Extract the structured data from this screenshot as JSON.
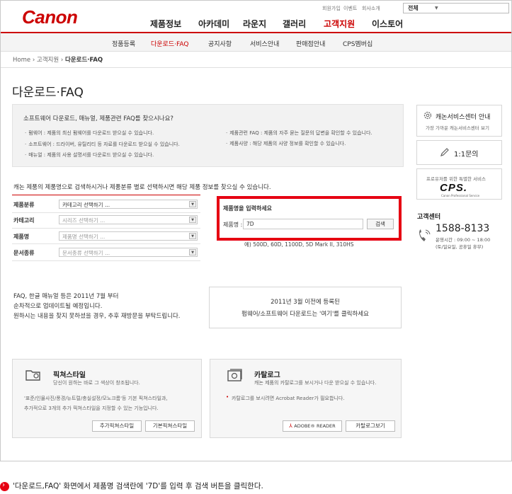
{
  "header": {
    "logo": "Canon",
    "util_links": [
      "회원가입",
      "이벤트",
      "회사소개"
    ],
    "search_select": "전체",
    "nav": [
      "제품정보",
      "아카데미",
      "라운지",
      "갤러리",
      "고객지원",
      "이스토어"
    ],
    "subnav": [
      "정품등록",
      "다운로드·FAQ",
      "공지사항",
      "서비스안내",
      "판매점안내",
      "CPS멤버십"
    ]
  },
  "breadcrumb": {
    "home": "Home",
    "level1": "고객지원",
    "current": "다운로드·FAQ"
  },
  "page_title": "다운로드·FAQ",
  "info": {
    "question": "소프트웨어 다운로드, 매뉴얼, 제품관련 FAQ를 찾으시나요?",
    "left_lines": [
      "펌웨어 : 제품의 최신 펌웨어를 다운로드 받으실 수 있습니다.",
      "소프트웨어 : 드라이버, 유틸리티 등 자료를 다운로드 받으실 수 있습니다.",
      "매뉴얼 : 제품의 사용 설명서를 다운로드 받으실 수 있습니다."
    ],
    "right_lines": [
      "제품관련 FAQ : 제품의 자주 묻는 질문의 답변을 확인할 수 있습니다.",
      "제품사양 : 해당 제품의 사양 정보를 확인할 수 있습니다."
    ]
  },
  "guide": "캐논 제품의 제품명으로 검색하시거나 제품분류 별로 선택하시면 해당 제품 정보를 찾으실 수 있습니다.",
  "filters": [
    {
      "label": "제품분류",
      "value": "카테고리 선택하기 ..."
    },
    {
      "label": "카테고리",
      "value": "시리즈 선택하기 ..."
    },
    {
      "label": "제품명",
      "value": "제품명 선택하기 ..."
    },
    {
      "label": "문서종류",
      "value": "문서종류 선택하기 ..."
    }
  ],
  "product_search": {
    "title": "제품명을 입력하세요",
    "label": "제품명 :",
    "value": "7D",
    "button": "검색",
    "example": "예) 500D, 60D, 1100D, 5D Mark II, 310HS"
  },
  "faq_notice": [
    "FAQ, 한글 매뉴얼 등은 2011년 7월 부터",
    "순차적으로 업데이트될 예정입니다.",
    "원하시는 내용을 찾지 못하셨을 경우, 추후 재방문을 부탁드립니다."
  ],
  "old_download": {
    "line1": "2011년 3월 이전에 등록된",
    "line2": "펌웨어/소프트웨어 다운로드는 '여기'를 클릭하세요"
  },
  "picture_style": {
    "title": "픽쳐스타일",
    "subtitle": "당신이 원하는 바로 그 색상이 창조됩니다.",
    "desc1": "'표준/인물사진/풍경/뉴트럴/충실설정/모노크롬'등 기본 픽쳐스타일과,",
    "desc2": "추가적으로 3개의 추가 픽쳐스타일을 지정할 수 있는 기능입니다.",
    "btn_add": "추가픽쳐스타일",
    "btn_basic": "기본픽쳐스타일"
  },
  "catalog": {
    "title": "카탈로그",
    "subtitle": "캐논 제품의 카탈로그를 보시거나 다운 받으실 수 있습니다.",
    "note": "카탈로그를 보시려면 Acrobat Reader가 필요합니다.",
    "btn_reader": "ADOBE® READER",
    "btn_view": "카탈로그보기"
  },
  "sidebar": {
    "service_title": "캐논서비스센터 안내",
    "service_sub": "가장 가까운 캐논서비스센터 보기",
    "inquiry": "1:1문의",
    "cps_sub": "프로유저를 위한 특별한 서비스",
    "cps_logo": "CPS.",
    "cps_small": "Canon Professional Service",
    "cs_title": "고객센터",
    "cs_phone": "1588-8133",
    "cs_hours1": "운영시간 : 09:00 ~ 18:00",
    "cs_hours2": "(토/일요일, 공휴일 휴무)"
  },
  "caption": "'다운로드,FAQ' 화면에서 제품명 검색란에 '7D'를 입력 후 검색 버튼을 클릭한다.",
  "colors": {
    "brand": "#cc0000",
    "highlight": "#e60012"
  }
}
